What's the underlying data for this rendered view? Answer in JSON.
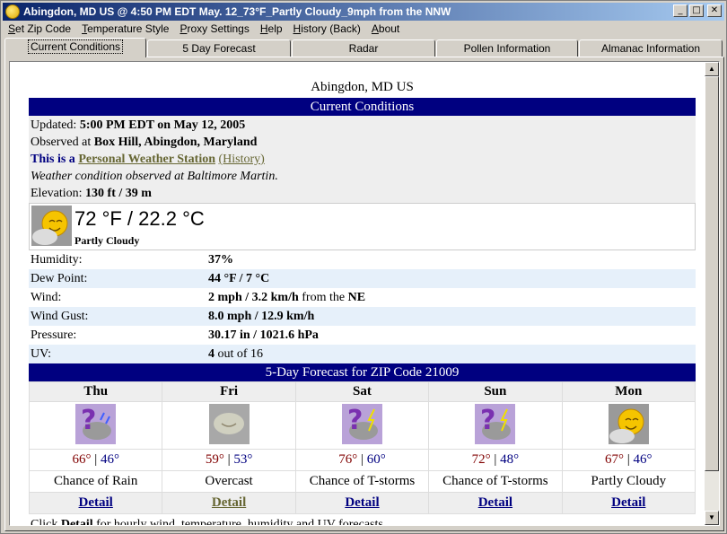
{
  "window": {
    "title": "Abingdon, MD US @ 4:50 PM EDT May. 12_73°F_Partly Cloudy_9mph from the NNW",
    "min": "_",
    "max": "□",
    "close": "✕"
  },
  "menu": [
    "Set Zip Code",
    "Temperature Style",
    "Proxy Settings",
    "Help",
    "History (Back)",
    "About"
  ],
  "tabs": [
    "Current Conditions",
    "5 Day Forecast",
    "Radar",
    "Pollen Information",
    "Almanac Information"
  ],
  "location": "Abingdon, MD US",
  "current": {
    "header": "Current Conditions",
    "updated_label": "Updated:",
    "updated_value": "5:00 PM EDT on May 12, 2005",
    "observed_label": "Observed at",
    "observed_value": "Box Hill, Abingdon, Maryland",
    "pws_lead": "This is a",
    "pws_link": "Personal Weather Station",
    "pws_history": "(History)",
    "observed_note": "Weather condition observed at Baltimore Martin.",
    "elevation_label": "Elevation:",
    "elevation_value": "130 ft / 39 m",
    "temperature": "72 °F / 22.2 °C",
    "condition": "Partly Cloudy",
    "icon": "partly-cloudy-icon"
  },
  "observations": [
    {
      "label": "Humidity:",
      "value": "37%",
      "suffix": ""
    },
    {
      "label": "Dew Point:",
      "value": "44 °F / 7 °C",
      "suffix": ""
    },
    {
      "label": "Wind:",
      "value": "2 mph / 3.2 km/h",
      "suffix": " from the ",
      "extra": "NE"
    },
    {
      "label": "Wind Gust:",
      "value": "8.0 mph / 12.9 km/h",
      "suffix": ""
    },
    {
      "label": "Pressure:",
      "value": "30.17 in / 1021.6 hPa",
      "suffix": ""
    },
    {
      "label": "UV:",
      "value": "4",
      "suffix": " out of 16"
    }
  ],
  "forecast": {
    "header": "5-Day Forecast for ZIP Code 21009",
    "days": [
      {
        "day": "Thu",
        "hi": "66°",
        "lo": "46°",
        "cond": "Chance of Rain",
        "detail": "Detail",
        "icon": "chance-rain-icon"
      },
      {
        "day": "Fri",
        "hi": "59°",
        "lo": "53°",
        "cond": "Overcast",
        "detail": "Detail",
        "icon": "overcast-icon"
      },
      {
        "day": "Sat",
        "hi": "76°",
        "lo": "60°",
        "cond": "Chance of T-storms",
        "detail": "Detail",
        "icon": "chance-tstorm-icon"
      },
      {
        "day": "Sun",
        "hi": "72°",
        "lo": "48°",
        "cond": "Chance of T-storms",
        "detail": "Detail",
        "icon": "chance-tstorm-icon"
      },
      {
        "day": "Mon",
        "hi": "67°",
        "lo": "46°",
        "cond": "Partly Cloudy",
        "detail": "Detail",
        "icon": "partly-cloudy-icon"
      }
    ],
    "footer_pre": "Click ",
    "footer_bold": "Detail",
    "footer_post": " for hourly wind, temperature, humidity and UV forecasts."
  }
}
